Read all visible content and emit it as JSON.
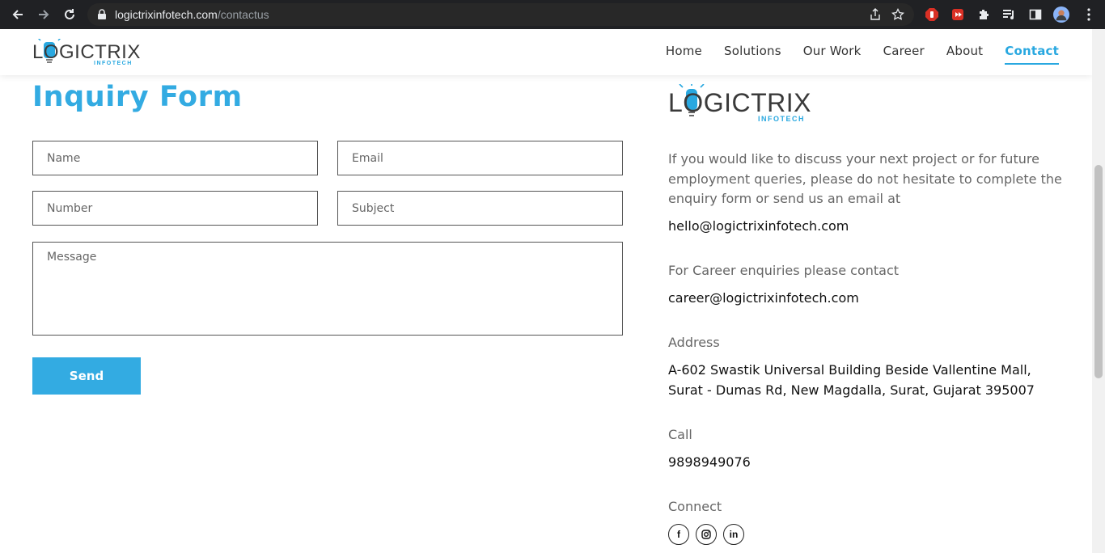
{
  "browser": {
    "url_domain": "logictrixinfotech.com",
    "url_path": "/contactus"
  },
  "header": {
    "logo_text": "LOGICTRIX",
    "logo_sub": "INFOTECH",
    "nav": [
      {
        "label": "Home"
      },
      {
        "label": "Solutions"
      },
      {
        "label": "Our Work"
      },
      {
        "label": "Career"
      },
      {
        "label": "About"
      },
      {
        "label": "Contact"
      }
    ],
    "active_nav": "Contact"
  },
  "form": {
    "title": "Inquiry Form",
    "name_placeholder": "Name",
    "email_placeholder": "Email",
    "number_placeholder": "Number",
    "subject_placeholder": "Subject",
    "message_placeholder": "Message",
    "send_label": "Send"
  },
  "info": {
    "logo_text": "LOGICTRIX",
    "logo_sub": "INFOTECH",
    "intro": "If you would like to discuss your next project or for future employment queries, please do not hesitate to complete the enquiry form or send us an email at",
    "email": "hello@logictrixinfotech.com",
    "career_label": "For Career enquiries please contact",
    "career_email": "career@logictrixinfotech.com",
    "address_label": "Address",
    "address": "A-602 Swastik Universal Building Beside Vallentine Mall, Surat - Dumas Rd, New Magdalla, Surat, Gujarat 395007",
    "call_label": "Call",
    "phone": "9898949076",
    "connect_label": "Connect",
    "social": [
      "f",
      "in"
    ]
  },
  "colors": {
    "accent": "#33abe2",
    "chrome": "#202124"
  }
}
